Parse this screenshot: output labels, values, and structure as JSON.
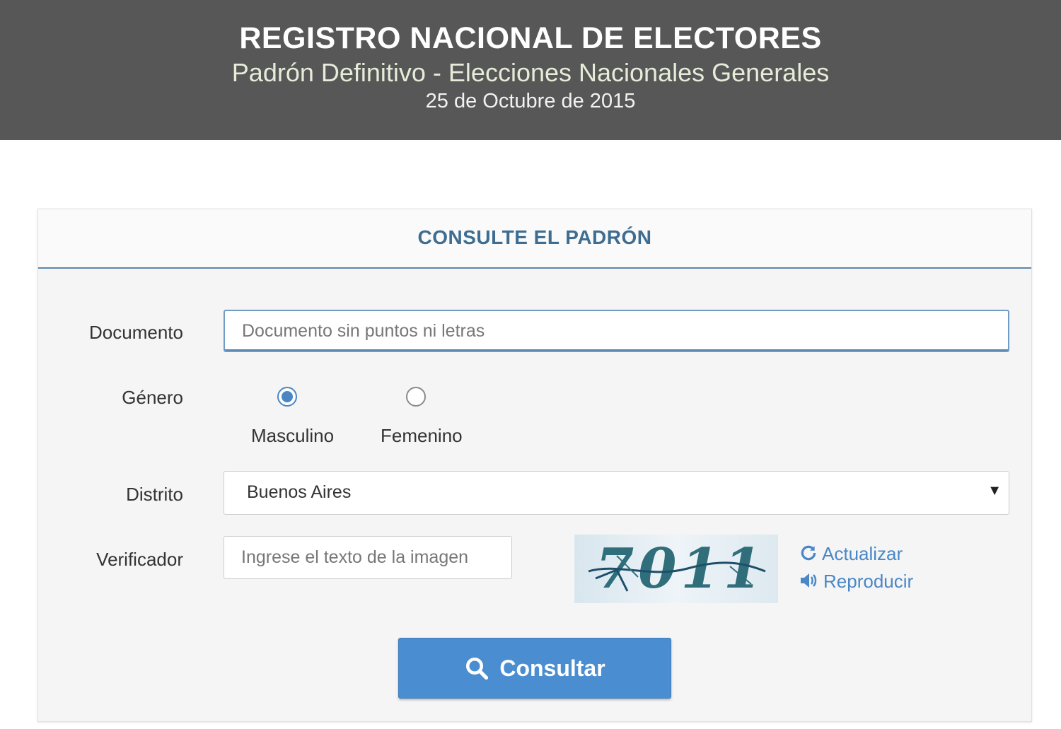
{
  "header": {
    "title": "REGISTRO NACIONAL DE ELECTORES",
    "subtitle": "Padrón Definitivo - Elecciones Nacionales Generales",
    "date": "25 de Octubre de 2015"
  },
  "panel": {
    "heading": "CONSULTE EL PADRÓN"
  },
  "form": {
    "documento": {
      "label": "Documento",
      "placeholder": "Documento sin puntos ni letras",
      "value": ""
    },
    "genero": {
      "label": "Género",
      "options": [
        {
          "label": "Masculino",
          "selected": true
        },
        {
          "label": "Femenino",
          "selected": false
        }
      ]
    },
    "distrito": {
      "label": "Distrito",
      "value": "Buenos Aires",
      "arrow_icon": "caret-down-icon"
    },
    "verificador": {
      "label": "Verificador",
      "placeholder": "Ingrese el texto de la imagen",
      "captcha_text": "7011",
      "refresh_label": "Actualizar",
      "refresh_icon": "refresh-icon",
      "play_label": "Reproducir",
      "play_icon": "volume-icon"
    },
    "submit": {
      "label": "Consultar",
      "icon": "search-icon"
    }
  },
  "colors": {
    "header_bg": "#575757",
    "accent": "#4b8dd1",
    "heading_text": "#3e6d91",
    "link": "#4a87c7"
  }
}
